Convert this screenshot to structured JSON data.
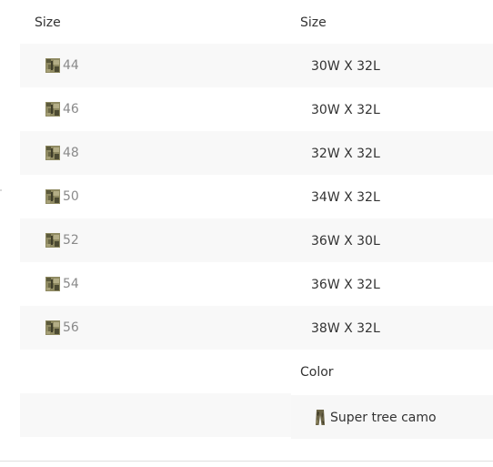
{
  "left_column": {
    "header": "Size",
    "options": [
      {
        "label": "44"
      },
      {
        "label": "46"
      },
      {
        "label": "48"
      },
      {
        "label": "50"
      },
      {
        "label": "52"
      },
      {
        "label": "54"
      },
      {
        "label": "56"
      }
    ]
  },
  "right_column": {
    "header": "Size",
    "values": [
      "30W X 32L",
      "30W X 32L",
      "32W X 32L",
      "34W X 32L",
      "36W X 30L",
      "36W X 32L",
      "38W X 32L"
    ],
    "color_header": "Color",
    "color_value": "Super tree camo"
  },
  "icons": {
    "size_swatch": "camo-pattern-swatch-icon",
    "color_swatch": "camo-pants-icon"
  },
  "colors": {
    "row_alt": "#f8f8f8",
    "text_primary": "#333333",
    "text_muted": "#8a8a8a",
    "camo_dark": "#5c5a3c",
    "camo_light": "#a8a27a"
  }
}
